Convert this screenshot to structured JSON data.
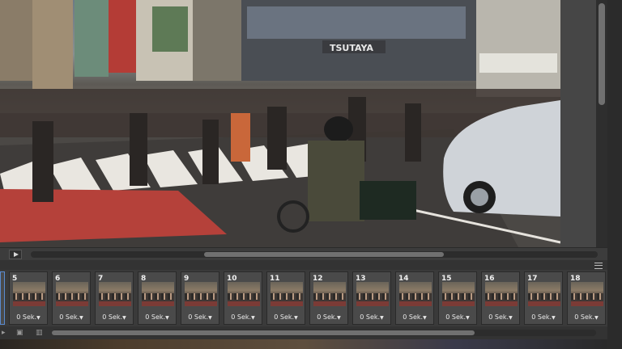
{
  "photo": {
    "description_icon": "street-crossing-photo",
    "storefront_sign": "TSUTAYA"
  },
  "timeline": {
    "play_icon": "play-icon"
  },
  "frames": [
    {
      "num": "5",
      "delay": "0 Sek."
    },
    {
      "num": "6",
      "delay": "0 Sek."
    },
    {
      "num": "7",
      "delay": "0 Sek."
    },
    {
      "num": "8",
      "delay": "0 Sek."
    },
    {
      "num": "9",
      "delay": "0 Sek."
    },
    {
      "num": "10",
      "delay": "0 Sek."
    },
    {
      "num": "11",
      "delay": "0 Sek."
    },
    {
      "num": "12",
      "delay": "0 Sek."
    },
    {
      "num": "13",
      "delay": "0 Sek."
    },
    {
      "num": "14",
      "delay": "0 Sek."
    },
    {
      "num": "15",
      "delay": "0 Sek."
    },
    {
      "num": "16",
      "delay": "0 Sek."
    },
    {
      "num": "17",
      "delay": "0 Sek."
    },
    {
      "num": "18",
      "delay": "0 Sek."
    }
  ],
  "colors": {
    "panel_bg": "#3a3a3a",
    "selection_accent": "#5a8bd0",
    "zebra_white": "#e9e6e0",
    "red_road": "#b5413a"
  }
}
